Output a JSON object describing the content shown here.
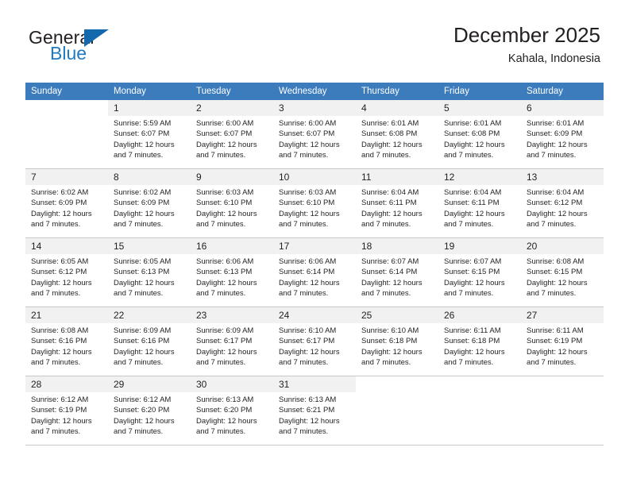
{
  "brand": {
    "name_top": "General",
    "name_bottom": "Blue",
    "accent_color": "#1f7ac4",
    "flag_color": "#1468ad"
  },
  "header": {
    "title": "December 2025",
    "subtitle": "Kahala, Indonesia",
    "header_bg": "#3c7cbd",
    "daynum_bg": "#f1f1f1"
  },
  "weekdays": [
    "Sunday",
    "Monday",
    "Tuesday",
    "Wednesday",
    "Thursday",
    "Friday",
    "Saturday"
  ],
  "weeks": [
    [
      {
        "day": "",
        "lines": []
      },
      {
        "day": "1",
        "lines": [
          "Sunrise: 5:59 AM",
          "Sunset: 6:07 PM",
          "Daylight: 12 hours",
          "and 7 minutes."
        ]
      },
      {
        "day": "2",
        "lines": [
          "Sunrise: 6:00 AM",
          "Sunset: 6:07 PM",
          "Daylight: 12 hours",
          "and 7 minutes."
        ]
      },
      {
        "day": "3",
        "lines": [
          "Sunrise: 6:00 AM",
          "Sunset: 6:07 PM",
          "Daylight: 12 hours",
          "and 7 minutes."
        ]
      },
      {
        "day": "4",
        "lines": [
          "Sunrise: 6:01 AM",
          "Sunset: 6:08 PM",
          "Daylight: 12 hours",
          "and 7 minutes."
        ]
      },
      {
        "day": "5",
        "lines": [
          "Sunrise: 6:01 AM",
          "Sunset: 6:08 PM",
          "Daylight: 12 hours",
          "and 7 minutes."
        ]
      },
      {
        "day": "6",
        "lines": [
          "Sunrise: 6:01 AM",
          "Sunset: 6:09 PM",
          "Daylight: 12 hours",
          "and 7 minutes."
        ]
      }
    ],
    [
      {
        "day": "7",
        "lines": [
          "Sunrise: 6:02 AM",
          "Sunset: 6:09 PM",
          "Daylight: 12 hours",
          "and 7 minutes."
        ]
      },
      {
        "day": "8",
        "lines": [
          "Sunrise: 6:02 AM",
          "Sunset: 6:09 PM",
          "Daylight: 12 hours",
          "and 7 minutes."
        ]
      },
      {
        "day": "9",
        "lines": [
          "Sunrise: 6:03 AM",
          "Sunset: 6:10 PM",
          "Daylight: 12 hours",
          "and 7 minutes."
        ]
      },
      {
        "day": "10",
        "lines": [
          "Sunrise: 6:03 AM",
          "Sunset: 6:10 PM",
          "Daylight: 12 hours",
          "and 7 minutes."
        ]
      },
      {
        "day": "11",
        "lines": [
          "Sunrise: 6:04 AM",
          "Sunset: 6:11 PM",
          "Daylight: 12 hours",
          "and 7 minutes."
        ]
      },
      {
        "day": "12",
        "lines": [
          "Sunrise: 6:04 AM",
          "Sunset: 6:11 PM",
          "Daylight: 12 hours",
          "and 7 minutes."
        ]
      },
      {
        "day": "13",
        "lines": [
          "Sunrise: 6:04 AM",
          "Sunset: 6:12 PM",
          "Daylight: 12 hours",
          "and 7 minutes."
        ]
      }
    ],
    [
      {
        "day": "14",
        "lines": [
          "Sunrise: 6:05 AM",
          "Sunset: 6:12 PM",
          "Daylight: 12 hours",
          "and 7 minutes."
        ]
      },
      {
        "day": "15",
        "lines": [
          "Sunrise: 6:05 AM",
          "Sunset: 6:13 PM",
          "Daylight: 12 hours",
          "and 7 minutes."
        ]
      },
      {
        "day": "16",
        "lines": [
          "Sunrise: 6:06 AM",
          "Sunset: 6:13 PM",
          "Daylight: 12 hours",
          "and 7 minutes."
        ]
      },
      {
        "day": "17",
        "lines": [
          "Sunrise: 6:06 AM",
          "Sunset: 6:14 PM",
          "Daylight: 12 hours",
          "and 7 minutes."
        ]
      },
      {
        "day": "18",
        "lines": [
          "Sunrise: 6:07 AM",
          "Sunset: 6:14 PM",
          "Daylight: 12 hours",
          "and 7 minutes."
        ]
      },
      {
        "day": "19",
        "lines": [
          "Sunrise: 6:07 AM",
          "Sunset: 6:15 PM",
          "Daylight: 12 hours",
          "and 7 minutes."
        ]
      },
      {
        "day": "20",
        "lines": [
          "Sunrise: 6:08 AM",
          "Sunset: 6:15 PM",
          "Daylight: 12 hours",
          "and 7 minutes."
        ]
      }
    ],
    [
      {
        "day": "21",
        "lines": [
          "Sunrise: 6:08 AM",
          "Sunset: 6:16 PM",
          "Daylight: 12 hours",
          "and 7 minutes."
        ]
      },
      {
        "day": "22",
        "lines": [
          "Sunrise: 6:09 AM",
          "Sunset: 6:16 PM",
          "Daylight: 12 hours",
          "and 7 minutes."
        ]
      },
      {
        "day": "23",
        "lines": [
          "Sunrise: 6:09 AM",
          "Sunset: 6:17 PM",
          "Daylight: 12 hours",
          "and 7 minutes."
        ]
      },
      {
        "day": "24",
        "lines": [
          "Sunrise: 6:10 AM",
          "Sunset: 6:17 PM",
          "Daylight: 12 hours",
          "and 7 minutes."
        ]
      },
      {
        "day": "25",
        "lines": [
          "Sunrise: 6:10 AM",
          "Sunset: 6:18 PM",
          "Daylight: 12 hours",
          "and 7 minutes."
        ]
      },
      {
        "day": "26",
        "lines": [
          "Sunrise: 6:11 AM",
          "Sunset: 6:18 PM",
          "Daylight: 12 hours",
          "and 7 minutes."
        ]
      },
      {
        "day": "27",
        "lines": [
          "Sunrise: 6:11 AM",
          "Sunset: 6:19 PM",
          "Daylight: 12 hours",
          "and 7 minutes."
        ]
      }
    ],
    [
      {
        "day": "28",
        "lines": [
          "Sunrise: 6:12 AM",
          "Sunset: 6:19 PM",
          "Daylight: 12 hours",
          "and 7 minutes."
        ]
      },
      {
        "day": "29",
        "lines": [
          "Sunrise: 6:12 AM",
          "Sunset: 6:20 PM",
          "Daylight: 12 hours",
          "and 7 minutes."
        ]
      },
      {
        "day": "30",
        "lines": [
          "Sunrise: 6:13 AM",
          "Sunset: 6:20 PM",
          "Daylight: 12 hours",
          "and 7 minutes."
        ]
      },
      {
        "day": "31",
        "lines": [
          "Sunrise: 6:13 AM",
          "Sunset: 6:21 PM",
          "Daylight: 12 hours",
          "and 7 minutes."
        ]
      },
      {
        "day": "",
        "lines": []
      },
      {
        "day": "",
        "lines": []
      },
      {
        "day": "",
        "lines": []
      }
    ]
  ]
}
